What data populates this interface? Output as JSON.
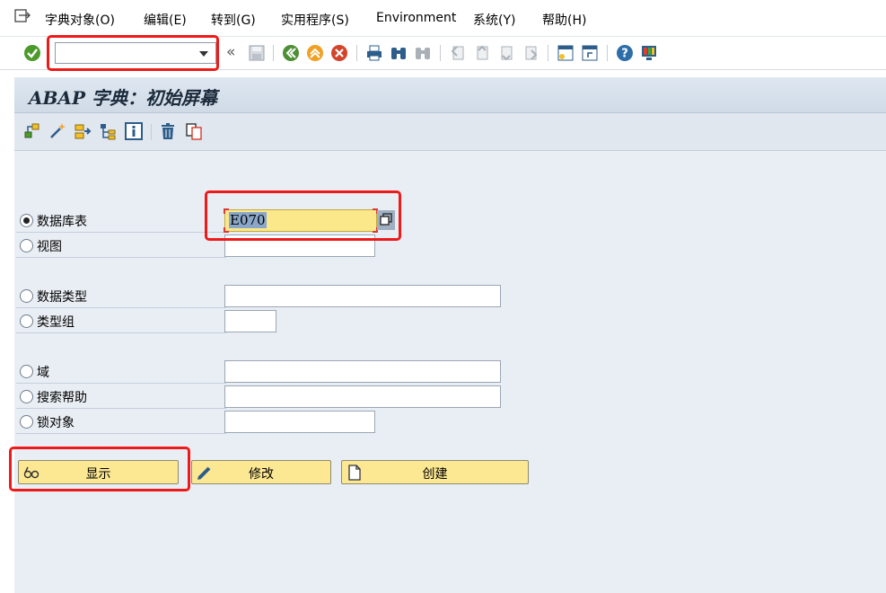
{
  "menu": {
    "items": [
      {
        "label": "字典对象(O)"
      },
      {
        "label": "编辑(E)"
      },
      {
        "label": "转到(G)"
      },
      {
        "label": "实用程序(S)"
      },
      {
        "label": "Environment"
      },
      {
        "label": "系统(Y)"
      },
      {
        "label": "帮助(H)"
      }
    ]
  },
  "toolbar": {
    "command_field_value": "",
    "back_glyph": "«",
    "icons": [
      "enter-check-icon",
      "save-icon",
      "back-icon",
      "exit-icon",
      "cancel-icon",
      "print-icon",
      "find-icon",
      "find-next-icon",
      "first-page-icon",
      "previous-page-icon",
      "next-page-icon",
      "last-page-icon",
      "new-session-icon",
      "shortcut-icon",
      "help-icon",
      "customize-layout-icon"
    ]
  },
  "screen": {
    "title": "ABAP 字典：初始屏幕"
  },
  "app_toolbar": {
    "icons": [
      "other-object-icon",
      "generate-icon",
      "where-used-icon",
      "hierarchy-icon",
      "info-icon",
      "delete-icon",
      "copy-icon"
    ]
  },
  "form": {
    "options": [
      {
        "label": "数据库表",
        "selected": true,
        "value": "E070"
      },
      {
        "label": "视图",
        "selected": false,
        "value": ""
      },
      {
        "label": "数据类型",
        "selected": false,
        "value": ""
      },
      {
        "label": "类型组",
        "selected": false,
        "value": ""
      },
      {
        "label": "域",
        "selected": false,
        "value": ""
      },
      {
        "label": "搜索帮助",
        "selected": false,
        "value": ""
      },
      {
        "label": "锁对象",
        "selected": false,
        "value": ""
      }
    ]
  },
  "buttons": {
    "display": "显示",
    "change": "修改",
    "create": "创建"
  },
  "colors": {
    "highlight_box": "#ee1a1a",
    "button_yellow": "#fce893",
    "active_field": "#fbe88b",
    "workarea": "#e9eef4"
  }
}
